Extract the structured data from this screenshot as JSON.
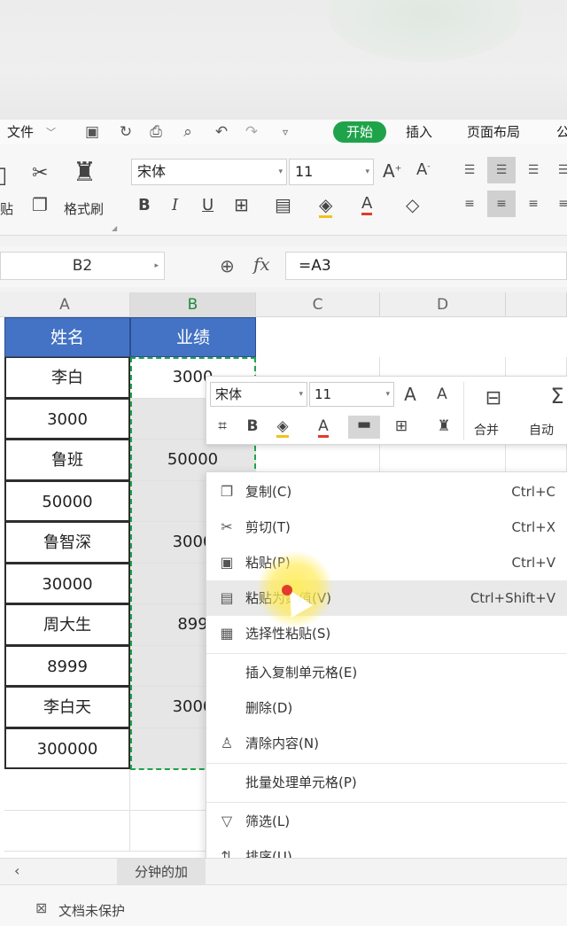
{
  "menubar": {
    "file": "文件",
    "start": "开始",
    "insert": "插入",
    "page_layout": "页面布局",
    "more": "公"
  },
  "ribbon": {
    "paste_label": "贴",
    "format_painter": "格式刷",
    "font_name": "宋体",
    "font_size": "11"
  },
  "formula_bar": {
    "name_box": "B2",
    "fx": "fx",
    "formula": "=A3"
  },
  "columns": [
    "A",
    "B",
    "C",
    "D"
  ],
  "table": {
    "headers": [
      "姓名",
      "业绩"
    ],
    "rows": [
      {
        "a": "李白",
        "b": "3000"
      },
      {
        "a": "3000",
        "b": ""
      },
      {
        "a": "鲁班",
        "b": "50000"
      },
      {
        "a": "50000",
        "b": ""
      },
      {
        "a": "鲁智深",
        "b": "3000"
      },
      {
        "a": "30000",
        "b": ""
      },
      {
        "a": "周大生",
        "b": "899"
      },
      {
        "a": "8999",
        "b": ""
      },
      {
        "a": "李白天",
        "b": "3000"
      },
      {
        "a": "300000",
        "b": ""
      }
    ]
  },
  "mini_toolbar": {
    "font_name": "宋体",
    "font_size": "11",
    "merge": "合并",
    "auto": "自动"
  },
  "context_menu": {
    "items": [
      {
        "label": "复制(C)",
        "shortcut": "Ctrl+C"
      },
      {
        "label": "剪切(T)",
        "shortcut": "Ctrl+X"
      },
      {
        "label": "粘贴(P)",
        "shortcut": "Ctrl+V"
      },
      {
        "label": "粘贴为数值(V)",
        "shortcut": "Ctrl+Shift+V"
      },
      {
        "label": "选择性粘贴(S)",
        "shortcut": ""
      },
      {
        "label": "插入复制单元格(E)",
        "shortcut": ""
      },
      {
        "label": "删除(D)",
        "shortcut": ""
      },
      {
        "label": "清除内容(N)",
        "shortcut": ""
      },
      {
        "label": "批量处理单元格(P)",
        "shortcut": ""
      },
      {
        "label": "筛选(L)",
        "shortcut": ""
      },
      {
        "label": "排序(U)",
        "shortcut": ""
      }
    ]
  },
  "sheet_tab": "分钟的加",
  "status": "文档未保护",
  "colors": {
    "accent_green": "#1fa34a",
    "header_blue": "#4472c4"
  }
}
